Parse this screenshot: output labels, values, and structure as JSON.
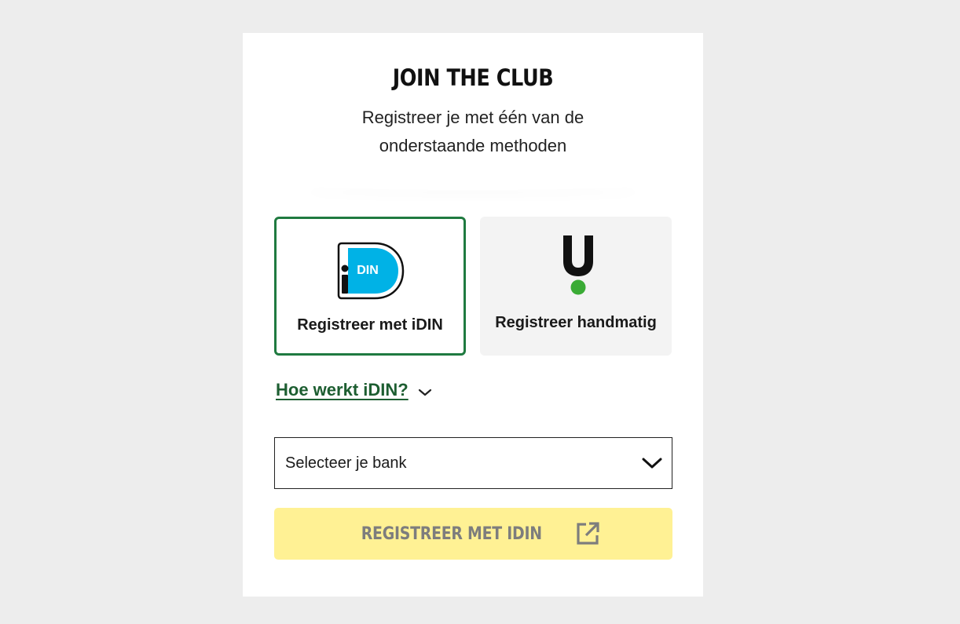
{
  "header": {
    "title": "JOIN THE CLUB",
    "subtitle": "Registreer je met één van de onderstaande methoden"
  },
  "methods": [
    {
      "label": "Registreer met iDIN",
      "logo_text": "DIN",
      "icon": "idin-logo",
      "selected": true
    },
    {
      "label": "Registreer handmatig",
      "icon": "u-logo",
      "selected": false
    }
  ],
  "howto": {
    "label": "Hoe werkt iDIN?",
    "icon": "chevron-down-icon"
  },
  "bank_select": {
    "value": "Selecteer je bank",
    "icon": "chevron-down-icon"
  },
  "submit": {
    "label": "REGISTREER MET IDIN",
    "icon": "external-link-icon",
    "disabled": true
  },
  "colors": {
    "background": "#ededed",
    "card": "#ffffff",
    "selected_border": "#1f7a40",
    "link": "#1d5e31",
    "idin_blue": "#00b2e6",
    "u_green_dot": "#3aab35",
    "button_disabled_bg": "#fff194",
    "button_disabled_text": "#7d7d7d"
  }
}
